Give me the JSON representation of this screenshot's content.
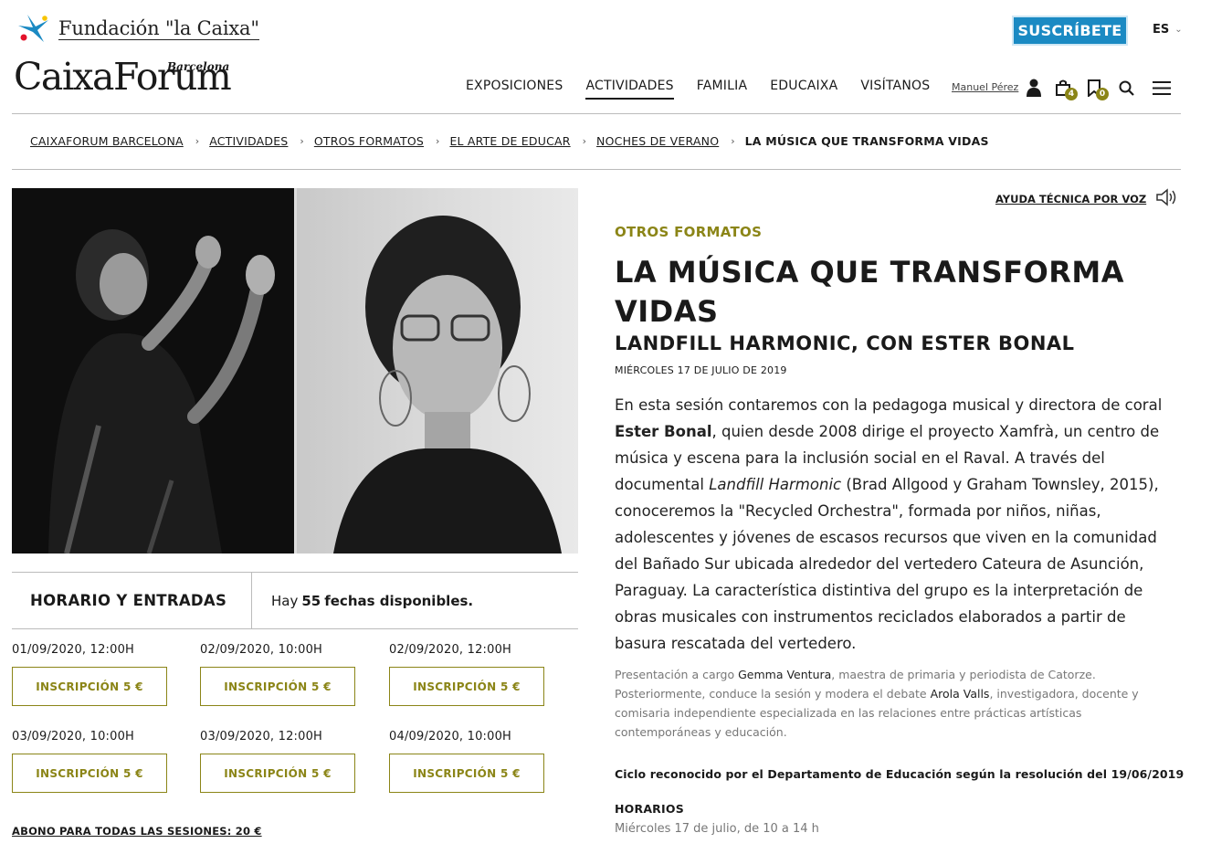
{
  "header": {
    "foundation_name": "Fundación \"la Caixa\"",
    "brand_name": "CaixaForum",
    "brand_city": "Barcelona",
    "subscribe_label": "SUSCRÍBETE",
    "lang_label": "ES",
    "nav": [
      "EXPOSICIONES",
      "ACTIVIDADES",
      "FAMILIA",
      "EDUCAIXA",
      "VISÍTANOS"
    ],
    "active_nav": "ACTIVIDADES",
    "user_name": "Manuel Pérez",
    "cart_count": "4",
    "saved_count": "0",
    "brand_color": "#1b8ac3",
    "accent_color": "#8b8517"
  },
  "breadcrumb": {
    "items": [
      "CAIXAFORUM BARCELONA",
      "ACTIVIDADES",
      "OTROS FORMATOS",
      "EL ARTE DE EDUCAR",
      "NOCHES DE VERANO"
    ],
    "current": "LA MÚSICA QUE TRANSFORMA VIDAS"
  },
  "schedule": {
    "title": "HORARIO Y ENTRADAS",
    "dates_prefix": "Hay",
    "dates_count": "55",
    "dates_suffix": "fechas disponibles.",
    "sessions": [
      {
        "date": "01/09/2020, 12:00H",
        "button": "INSCRIPCIÓN 5 €"
      },
      {
        "date": "02/09/2020, 10:00H",
        "button": "INSCRIPCIÓN 5 €"
      },
      {
        "date": "02/09/2020, 12:00H",
        "button": "INSCRIPCIÓN 5 €"
      },
      {
        "date": "03/09/2020, 10:00H",
        "button": "INSCRIPCIÓN 5 €"
      },
      {
        "date": "03/09/2020, 12:00H",
        "button": "INSCRIPCIÓN 5 €"
      },
      {
        "date": "04/09/2020, 10:00H",
        "button": "INSCRIPCIÓN 5 €"
      }
    ],
    "abono": "ABONO PARA TODAS LAS SESIONES: 20 €"
  },
  "article": {
    "voice_help": "AYUDA TÉCNICA POR VOZ",
    "category": "OTROS FORMATOS",
    "title": "LA MÚSICA QUE TRANSFORMA VIDAS",
    "subtitle": "LANDFILL HARMONIC, CON ESTER BONAL",
    "date": "MIÉRCOLES 17 DE JULIO DE 2019",
    "desc_1": "En esta sesión contaremos con la pedagoga musical y directora de coral",
    "desc_name": "Ester Bonal",
    "desc_2": ", quien desde 2008 dirige el proyecto Xamfrà, un centro de música y escena para la inclusión social en el Raval. A través del documental",
    "desc_film": "Landfill Harmonic",
    "desc_3": "(Brad Allgood y Graham Townsley, 2015), conoceremos la \"Recycled Orchestra\", formada por niños, niñas, adolescentes y jóvenes de escasos recursos que viven en la comunidad del Bañado Sur ubicada alrededor del vertedero Cateura de Asunción, Paraguay. La característica distintiva del grupo es la interpretación de obras musicales con instrumentos reciclados elaborados a partir de basura rescatada del vertedero.",
    "pres_1": "Presentación a cargo",
    "pres_name1": "Gemma Ventura",
    "pres_2": ", maestra de primaria y periodista de Catorze. Posteriormente, conduce la sesión y modera el debate",
    "pres_name2": "Arola Valls",
    "pres_3": ", investigadora, docente y comisaria independiente especializada en las relaciones entre prácticas artísticas contemporáneas y educación.",
    "ciclo": "Ciclo reconocido por el Departamento de Educación según la resolución del 19/06/2019",
    "horarios_heading": "HORARIOS",
    "horarios_value": "Miércoles 17 de julio, de 10 a 14 h"
  }
}
